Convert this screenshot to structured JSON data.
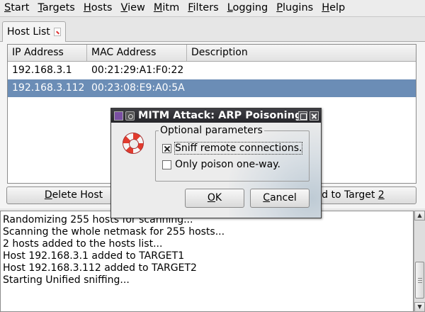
{
  "menubar": {
    "items": [
      {
        "mn": "S",
        "rest": "tart"
      },
      {
        "mn": "T",
        "rest": "argets"
      },
      {
        "mn": "H",
        "rest": "osts"
      },
      {
        "mn": "V",
        "rest": "iew"
      },
      {
        "mn": "M",
        "rest": "itm"
      },
      {
        "mn": "F",
        "rest": "ilters"
      },
      {
        "mn": "L",
        "rest": "ogging"
      },
      {
        "mn": "P",
        "rest": "lugins"
      },
      {
        "mn": "H",
        "rest": "elp"
      }
    ]
  },
  "tab": {
    "label": "Host List"
  },
  "hosts": {
    "columns": [
      "IP Address",
      "MAC Address",
      "Description"
    ],
    "rows": [
      {
        "ip": "192.168.3.1",
        "mac": "00:21:29:A1:F0:22",
        "desc": ""
      },
      {
        "ip": "192.168.3.112",
        "mac": "00:23:08:E9:A0:5A",
        "desc": ""
      }
    ]
  },
  "buttons": {
    "delete_pre": "",
    "delete_mn": "D",
    "delete_post": "elete Host",
    "target2_pre": "dd to Target ",
    "target2_mn": "2"
  },
  "log": {
    "lines": [
      "Randomizing 255 hosts for scanning...",
      "Scanning the whole netmask for 255 hosts...",
      "2 hosts added to the hosts list...",
      "Host 192.168.3.1 added to TARGET1",
      "Host 192.168.3.112 added to TARGET2",
      "Starting Unified sniffing..."
    ]
  },
  "dialog": {
    "title": "MITM Attack: ARP Poisoning",
    "group_label": "Optional parameters",
    "options": [
      {
        "label": "Sniff remote connections.",
        "checked": true
      },
      {
        "label": "Only poison one-way.",
        "checked": false
      }
    ],
    "ok_mn": "O",
    "ok_rest": "K",
    "cancel_mn": "C",
    "cancel_rest": "ancel"
  }
}
